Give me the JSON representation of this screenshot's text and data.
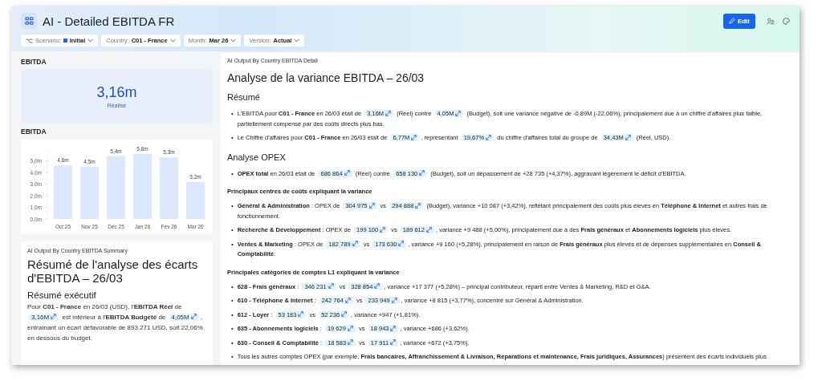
{
  "header": {
    "title": "AI - Detailed EBITDA FR",
    "edit_button": "Edit"
  },
  "filters": [
    {
      "label": "Scenario:",
      "value": "Initial",
      "color": "#2563eb",
      "kind": "scenario"
    },
    {
      "label": "Country:",
      "value": "C01 - France",
      "kind": "plain"
    },
    {
      "label": "Month:",
      "value": "Mar 26",
      "kind": "plain"
    },
    {
      "label": "Version:",
      "value": "Actual",
      "kind": "plain"
    }
  ],
  "kpi": {
    "heading": "EBITDA",
    "value": "3,16m",
    "caption": "Réalisé"
  },
  "chart": {
    "heading": "EBITDA",
    "chart_data": {
      "type": "bar",
      "categories": [
        "Oct 25",
        "Nov 25",
        "Déc 25",
        "Jan 26",
        "Fév 26",
        "Mar 26"
      ],
      "series": [
        {
          "color": "#dbe8fe",
          "values": [
            4.6,
            4.5,
            5.4,
            5.6,
            5.3,
            3.2
          ]
        }
      ],
      "ylim": [
        0,
        5.8
      ],
      "yticks": [
        {
          "value": 0,
          "label": "0,0m"
        },
        {
          "value": 1,
          "label": "1,0m"
        },
        {
          "value": 2,
          "label": "2,0m"
        },
        {
          "value": 3,
          "label": "3,0m"
        },
        {
          "value": 4,
          "label": "4,0m"
        },
        {
          "value": 5,
          "label": "5,0m"
        }
      ],
      "value_labels": [
        "4,6m",
        "4,5m",
        "5,4m",
        "5,6m",
        "5,3m",
        "3,2m"
      ]
    }
  },
  "summary": {
    "source": "AI Output By Country EBITDA Summary",
    "title": "Résumé de l'analyse des écarts d'EBITDA – 26/03",
    "subtitle": "Résumé exécutif",
    "paragraph": [
      {
        "kind": "text",
        "text": "Pour **C01 - France** en 26/03 (USD), l'**EBITDA Réel** de "
      },
      {
        "kind": "chip",
        "text": "3,16M"
      },
      {
        "kind": "text",
        "text": " est inférieur à l'**EBITDA Budgété** de "
      },
      {
        "kind": "chip",
        "text": "4,05M"
      },
      {
        "kind": "text",
        "text": ", entraînant un écart défavorable de 893 271 USD, soit 22,06% en dessous du budget."
      }
    ]
  },
  "detail": {
    "source": "AI Output By Country EBITDA Detail",
    "title": "Analyse de la variance EBITDA – 26/03",
    "blocks": [
      {
        "kind": "heading",
        "text": "Résumé"
      },
      {
        "kind": "bullets",
        "marker": "•",
        "items": [
          [
            {
              "kind": "text",
              "text": "L'EBITDA pour **C01 - France** en 26/03 était de "
            },
            {
              "kind": "chip",
              "text": "3,16M"
            },
            {
              "kind": "text",
              "text": " (Réel) contre "
            },
            {
              "kind": "chip",
              "text": "4,05M"
            },
            {
              "kind": "text",
              "text": " (Budget), soit une variance négative de -0,89M (-22,06%), principalement due à un chiffre d'affaires plus faible, partiellement compensé par des coûts directs plus bas."
            }
          ],
          [
            {
              "kind": "text",
              "text": "Le Chiffre d'affaires pour **C01 - France** en 26/03 était de "
            },
            {
              "kind": "chip",
              "text": "6,77M"
            },
            {
              "kind": "text",
              "text": ", représentant "
            },
            {
              "kind": "chip",
              "text": "19,67%"
            },
            {
              "kind": "text",
              "text": " du chiffre d'affaires total du groupe de "
            },
            {
              "kind": "chip",
              "text": "34,43M"
            },
            {
              "kind": "text",
              "text": " (Réel, USD)."
            }
          ]
        ]
      },
      {
        "kind": "heading",
        "text": "Analyse OPEX"
      },
      {
        "kind": "bullets",
        "marker": "•",
        "items": [
          [
            {
              "kind": "text",
              "text": "**OPEX total** en 26/03 était de "
            },
            {
              "kind": "chip",
              "text": "686 864"
            },
            {
              "kind": "text",
              "text": " (Réel) contre "
            },
            {
              "kind": "chip",
              "text": "658 130"
            },
            {
              "kind": "text",
              "text": " (Budget), soit un dépassement de +28 735 (+4,37%), aggravant légèrement le déficit d'EBITDA."
            }
          ]
        ]
      },
      {
        "kind": "subheading",
        "text": "Principaux centres de coûts expliquant la variance"
      },
      {
        "kind": "bullets",
        "marker": "•",
        "items": [
          [
            {
              "kind": "text",
              "text": "**Général & Administration** : OPEX de "
            },
            {
              "kind": "chip",
              "text": "304 975"
            },
            {
              "kind": "text",
              "text": " vs "
            },
            {
              "kind": "chip",
              "text": "294 888"
            },
            {
              "kind": "text",
              "text": " (Budget), variance +10 087 (+3,42%), reflétant principalement des coûts plus élevés en **Téléphone & Internet** et autres frais de fonctionnement."
            }
          ],
          [
            {
              "kind": "text",
              "text": "**Recherche & Développement** : OPEX de "
            },
            {
              "kind": "chip",
              "text": "199 100"
            },
            {
              "kind": "text",
              "text": " vs "
            },
            {
              "kind": "chip",
              "text": "189 612"
            },
            {
              "kind": "text",
              "text": ", variance +9 488 (+5,00%), principalement due à des **Frais généraux** et **Abonnements logiciels** plus élevés."
            }
          ],
          [
            {
              "kind": "text",
              "text": "**Ventes & Marketing** : OPEX de "
            },
            {
              "kind": "chip",
              "text": "182 789"
            },
            {
              "kind": "text",
              "text": " vs "
            },
            {
              "kind": "chip",
              "text": "173 630"
            },
            {
              "kind": "text",
              "text": ", variance +9 160 (+5,28%), principalement en raison de **Frais généraux** plus élevés et de dépenses supplémentaires en **Conseil & Comptabilité**."
            }
          ]
        ]
      },
      {
        "kind": "subheading",
        "text": "Principales catégories de comptes L1 expliquant la variance"
      },
      {
        "kind": "bullets",
        "marker": "•",
        "items": [
          [
            {
              "kind": "text",
              "text": "**628 - Frais généraux** : "
            },
            {
              "kind": "chip",
              "text": "346 231"
            },
            {
              "kind": "text",
              "text": " vs "
            },
            {
              "kind": "chip",
              "text": "328 854"
            },
            {
              "kind": "text",
              "text": ", variance +17 377 (+5,28%) – principal contributeur, réparti entre Ventes & Marketing, R&D et G&A."
            }
          ],
          [
            {
              "kind": "text",
              "text": "**610 - Téléphone & Internet** : "
            },
            {
              "kind": "chip",
              "text": "242 764"
            },
            {
              "kind": "text",
              "text": " vs "
            },
            {
              "kind": "chip",
              "text": "233 949"
            },
            {
              "kind": "text",
              "text": ", variance +8 815 (+3,77%), concentré sur Général & Administration."
            }
          ],
          [
            {
              "kind": "text",
              "text": "**612 - Loyer** : "
            },
            {
              "kind": "chip",
              "text": "53 183"
            },
            {
              "kind": "text",
              "text": " vs "
            },
            {
              "kind": "chip",
              "text": "52 236"
            },
            {
              "kind": "text",
              "text": ", variance +947 (+1,81%)."
            }
          ],
          [
            {
              "kind": "text",
              "text": "**635 - Abonnements logiciels** : "
            },
            {
              "kind": "chip",
              "text": "19 629"
            },
            {
              "kind": "text",
              "text": " vs "
            },
            {
              "kind": "chip",
              "text": "18 943"
            },
            {
              "kind": "text",
              "text": ", variance +686 (+3,62%)."
            }
          ],
          [
            {
              "kind": "text",
              "text": "**630 - Conseil & Comptabilité** : "
            },
            {
              "kind": "chip",
              "text": "18 583"
            },
            {
              "kind": "text",
              "text": " vs "
            },
            {
              "kind": "chip",
              "text": "17 911"
            },
            {
              "kind": "text",
              "text": ", variance +672 (+3,75%)."
            }
          ],
          [
            {
              "kind": "text",
              "text": "Tous les autres comptes OPEX (par exemple, **Frais bancaires, Affranchissement & Livraison, Réparations et maintenance, Frais juridiques, Assurances**) présentent des écarts individuels plus"
            }
          ]
        ]
      }
    ]
  }
}
